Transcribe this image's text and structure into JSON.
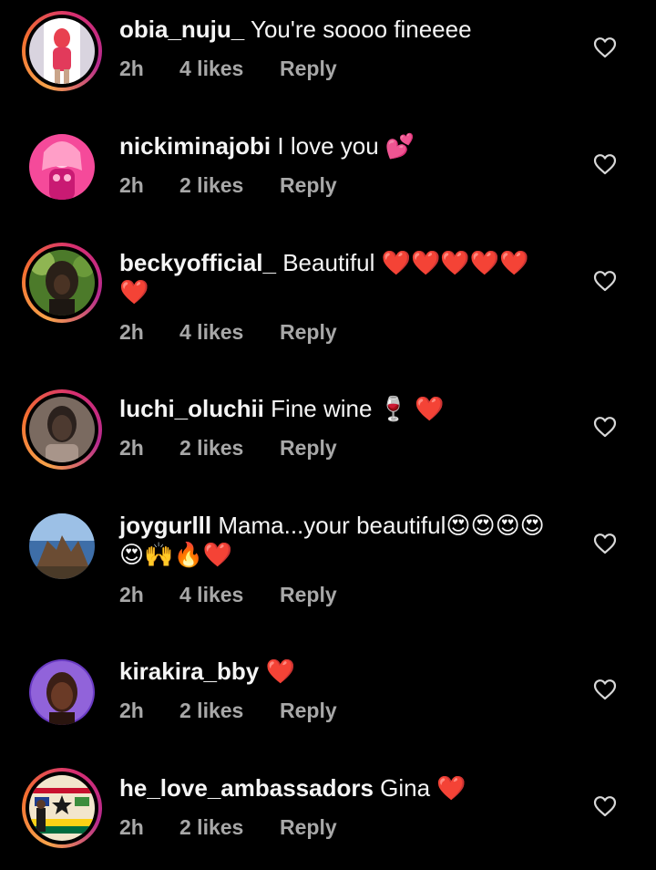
{
  "comments": [
    {
      "username": "obia_nuju_",
      "text": "You're soooo fineeee",
      "time": "2h",
      "likes": "4 likes",
      "reply": "Reply",
      "avatar_colors": [
        "#cfc6d8",
        "#e23a5b",
        "#f2f2f2"
      ]
    },
    {
      "username": "nickiminajobi",
      "text": "I love you 💕",
      "time": "2h",
      "likes": "2 likes",
      "reply": "Reply",
      "avatar_colors": [
        "#f54a9a",
        "#ffb7d4",
        "#c91a73"
      ]
    },
    {
      "username": "beckyofficial_",
      "text": "Beautiful ❤️❤️❤️❤️❤️❤️",
      "time": "2h",
      "likes": "4 likes",
      "reply": "Reply",
      "avatar_colors": [
        "#4c7a2a",
        "#2a2018",
        "#8fb552"
      ]
    },
    {
      "username": "luchi_oluchii",
      "text": "Fine wine 🍷 ❤️",
      "time": "2h",
      "likes": "2 likes",
      "reply": "Reply",
      "avatar_colors": [
        "#7a6a60",
        "#2b211d",
        "#a8958a"
      ]
    },
    {
      "username": "joygurlll",
      "text": "Mama...your beautiful😍😍😍😍😍🙌🔥❤️",
      "time": "2h",
      "likes": "4 likes",
      "reply": "Reply",
      "avatar_colors": [
        "#3e6ea8",
        "#6b4c33",
        "#9cc0e6"
      ]
    },
    {
      "username": "kirakira_bby",
      "text": "❤️",
      "time": "2h",
      "likes": "2 likes",
      "reply": "Reply",
      "avatar_colors": [
        "#6a3bc4",
        "#3b1f16",
        "#b78cf0"
      ]
    },
    {
      "username": "he_love_ambassadors",
      "text": "Gina ❤️",
      "time": "2h",
      "likes": "2 likes",
      "reply": "Reply",
      "avatar_colors": [
        "#f2e6cc",
        "#1a1a1a",
        "#c8102e"
      ]
    }
  ],
  "colors": {
    "background": "#000000",
    "username": "#f5f5f5",
    "meta": "#a8a8a8",
    "heart_outline": "#d8d8d8"
  },
  "icons": {
    "like": "heart-outline-icon"
  }
}
